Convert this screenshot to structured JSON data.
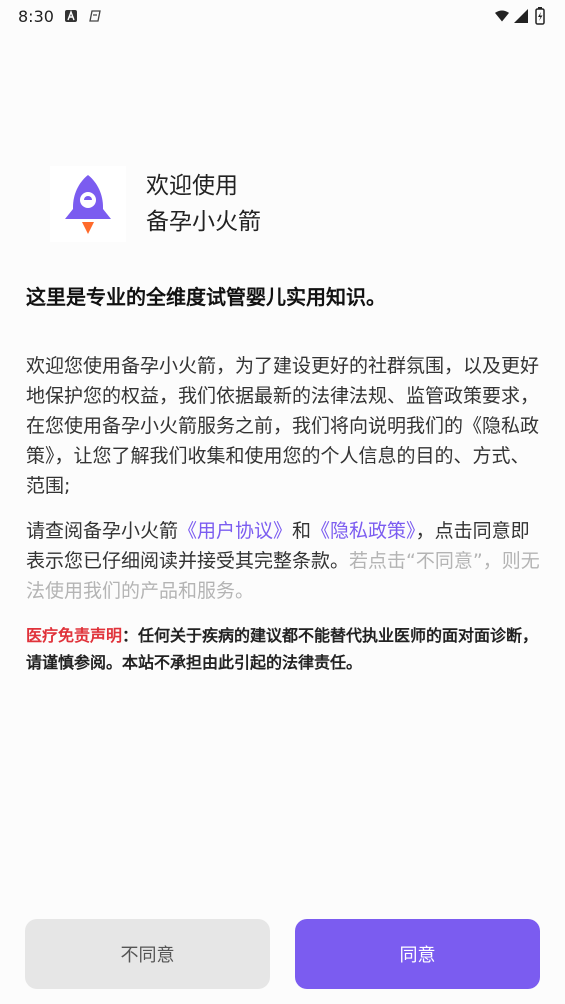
{
  "status_bar": {
    "time": "8:30"
  },
  "header": {
    "welcome_line1": "欢迎使用",
    "welcome_line2": "备孕小火箭"
  },
  "headline": "这里是专业的全维度试管婴儿实用知识。",
  "paragraph1": "欢迎您使用备孕小火箭，为了建设更好的社群氛围，以及更好地保护您的权益，我们依据最新的法律法规、监管政策要求，在您使用备孕小火箭服务之前，我们将向说明我们的《隐私政策》，让您了解我们收集和使用您的个人信息的目的、方式、范围;",
  "paragraph2": {
    "prefix": "请查阅备孕小火箭",
    "user_agreement_link": "《用户协议》",
    "conjunction": "和",
    "privacy_policy_link": "《隐私政策》",
    "middle": "，点击同意即表示您已仔细阅读并接受其完整条款。",
    "muted_suffix": "若点击“不同意”，则无法使用我们的产品和服务。"
  },
  "disclaimer": {
    "label": "医疗免责声明",
    "text": "：任何关于疾病的建议都不能替代执业医师的面对面诊断，请谨慎参阅。本站不承担由此引起的法律责任。"
  },
  "buttons": {
    "disagree": "不同意",
    "agree": "同意"
  },
  "colors": {
    "accent": "#7b5cf0",
    "danger": "#e0323a",
    "muted": "#b4b4b4"
  }
}
